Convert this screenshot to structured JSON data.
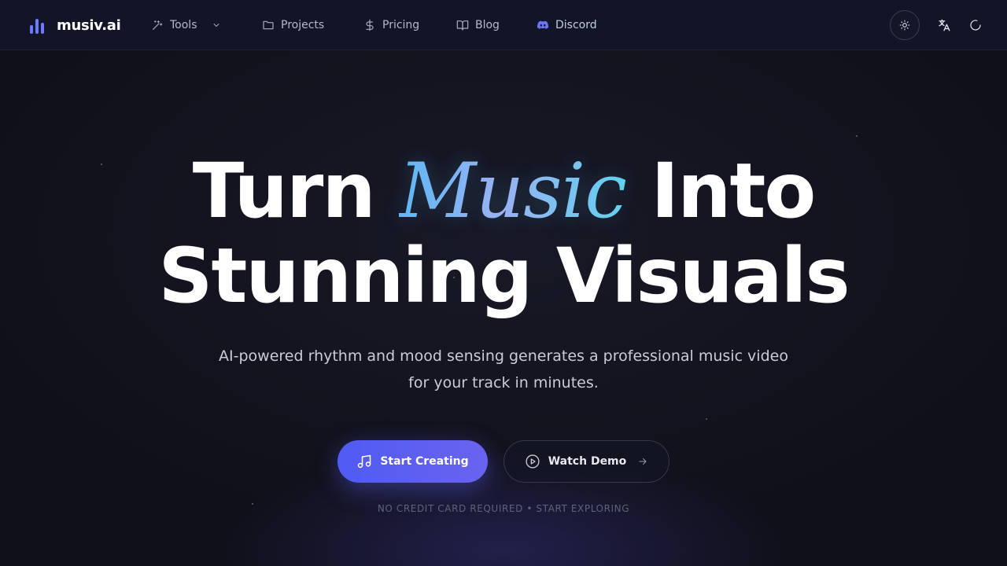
{
  "nav": {
    "brand": "musiv.ai",
    "items": [
      {
        "label": "Tools",
        "icon": "magic-wand-icon"
      },
      {
        "label": "Projects",
        "icon": "folder-icon"
      },
      {
        "label": "Pricing",
        "icon": "dollar-icon"
      },
      {
        "label": "Blog",
        "icon": "book-icon"
      },
      {
        "label": "Discord",
        "icon": "discord-icon"
      }
    ],
    "actions": [
      "sun-icon",
      "translate-icon",
      "loader-icon"
    ]
  },
  "hero": {
    "title_part1": "Turn ",
    "title_accent": "Music",
    "title_part2": " Into",
    "title_line2": "Stunning Visuals",
    "subtitle_line1": "AI-powered rhythm and mood sensing generates a professional music video",
    "subtitle_line2": "for your track in minutes.",
    "primary_cta": "Start Creating",
    "secondary_cta": "Watch Demo",
    "footnote": "NO CREDIT CARD REQUIRED • START EXPLORING"
  },
  "colors": {
    "background": "#0f1019",
    "nav_background": "#121527",
    "brand": "#6b7cff",
    "primary_button": "#5a5ff2",
    "discord": "#5865f2",
    "accent_gradient": [
      "#5fb8f3",
      "#9fb2f2",
      "#63d3ee"
    ]
  }
}
